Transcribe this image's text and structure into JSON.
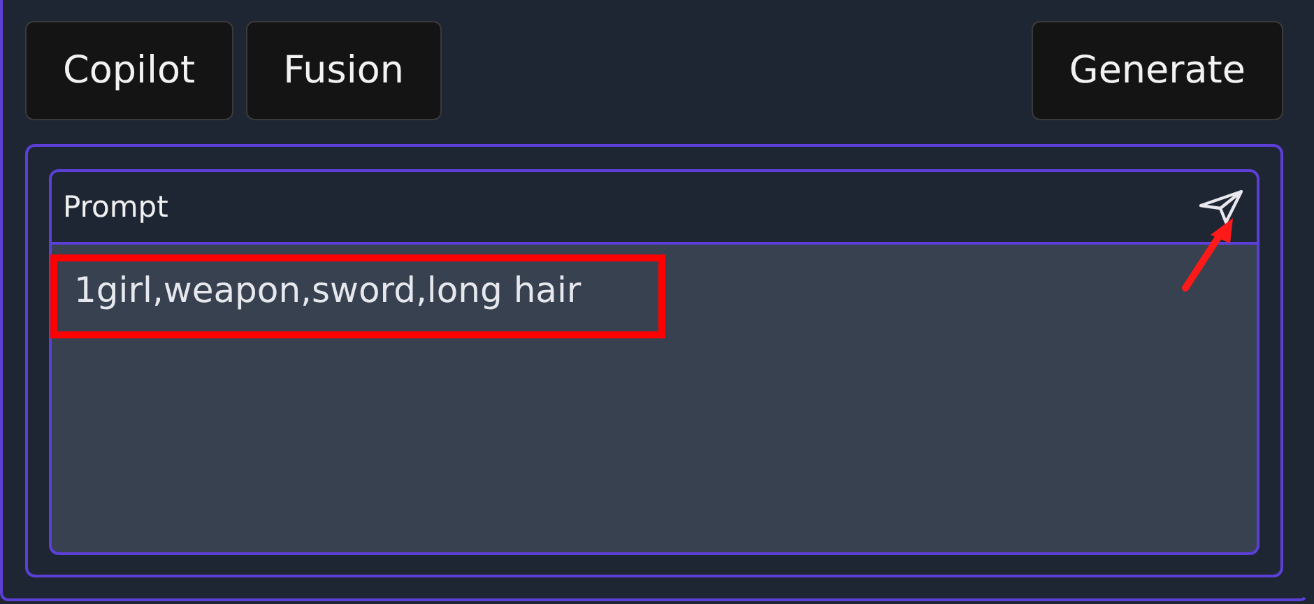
{
  "toolbar": {
    "buttons": [
      {
        "label": "Copilot"
      },
      {
        "label": "Fusion"
      }
    ],
    "primary_button": {
      "label": "Generate"
    }
  },
  "prompt_panel": {
    "title": "Prompt",
    "value": "1girl,weapon,sword,long hair"
  },
  "annotations": {
    "highlight_box": true,
    "arrow": true
  }
}
